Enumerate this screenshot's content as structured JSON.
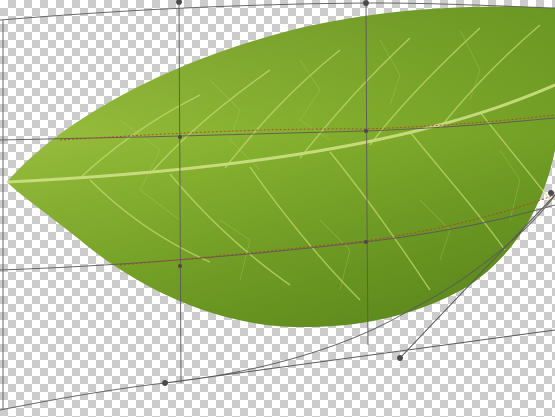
{
  "document": {
    "background": "transparency-checkerboard",
    "checker_colors": [
      "#ffffff",
      "#cccccc"
    ]
  },
  "layer": {
    "subject": "leaf",
    "colors": {
      "leaf_light": "#9bc13a",
      "leaf_mid": "#7da72a",
      "leaf_dark": "#4f7a16",
      "vein": "#c7dc77"
    }
  },
  "transform": {
    "mode": "warp",
    "grid_color": "#5a5a5a",
    "guide_color": "#c0392b",
    "handle_color": "#4a4a4a"
  }
}
